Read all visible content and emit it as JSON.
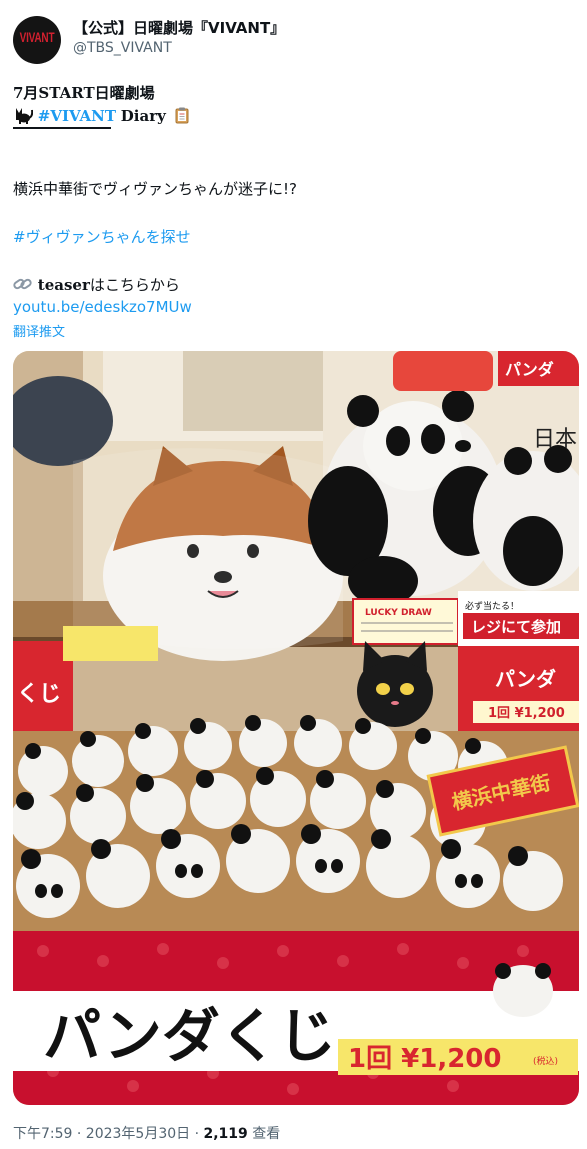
{
  "account": {
    "avatar_text": "VIVANT",
    "display_name": "【公式】日曜劇場『VIVANT』",
    "handle": "@TBS_VIVANT"
  },
  "post": {
    "line1": "7月START日曜劇場",
    "hashtag": "#VIVANT",
    "diary_word": "Diary",
    "headline": "横浜中華街でヴィヴァンちゃんが迷子に!?",
    "hashtag2": "#ヴィヴァンちゃんを探せ",
    "teaser_bold": "teaser",
    "teaser_rest": "はこちらから",
    "link_text": "youtu.be/edeskzo7MUw",
    "translate_label": "翻译推文"
  },
  "photo": {
    "sign_lucky_draw": "LUCKY DRAW",
    "sign_register": "レジにて参加",
    "sign_register_small": "必ず当たる！",
    "sign_panda": "パンダ",
    "sign_price_small": "1回 ¥1,200",
    "sign_japan": "日本",
    "banner_main": "パンダくじ",
    "banner_price": "1回 ¥1,200",
    "banner_tax": "(税込)",
    "chinatown_tag": "横浜中華街",
    "left_sign": "くじ"
  },
  "meta": {
    "time": "下午7:59 · 2023年5月30日 · ",
    "views_count": "2,119",
    "views_label": " 查看"
  },
  "colors": {
    "link": "#1d9bf0",
    "secondary_text": "#536471",
    "banner_red": "#c8102e"
  }
}
